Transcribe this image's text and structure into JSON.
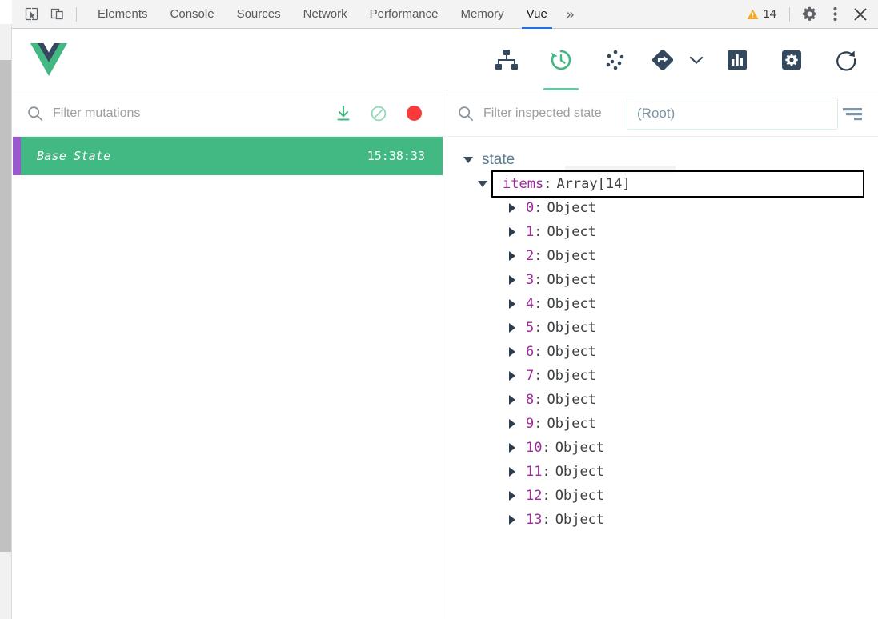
{
  "devtools": {
    "icons": {
      "inspect": "inspect-element-icon",
      "device": "device-toolbar-icon",
      "more": "»",
      "warning": "warning-triangle-icon",
      "settings": "gear-icon",
      "kebab": "more-options-icon",
      "close": "close-icon"
    },
    "tabs": [
      {
        "label": "Elements",
        "active": false
      },
      {
        "label": "Console",
        "active": false
      },
      {
        "label": "Sources",
        "active": false
      },
      {
        "label": "Network",
        "active": false
      },
      {
        "label": "Performance",
        "active": false
      },
      {
        "label": "Memory",
        "active": false
      },
      {
        "label": "Vue",
        "active": true
      }
    ],
    "more_label": "»",
    "warning_count": "14"
  },
  "vue_header": {
    "logo": "vue-logo",
    "accent": "#42b883",
    "tools": [
      {
        "name": "components-tree-icon",
        "active": false
      },
      {
        "name": "time-travel-icon",
        "active": true
      },
      {
        "name": "vuex-dots-icon",
        "active": false
      },
      {
        "name": "routing-icon",
        "active": false
      },
      {
        "name": "chevron-down-icon",
        "active": false
      },
      {
        "name": "performance-bars-icon",
        "active": false
      },
      {
        "name": "settings-gear-icon",
        "active": false
      },
      {
        "name": "refresh-icon",
        "active": false
      }
    ]
  },
  "left_pane": {
    "filter": {
      "placeholder": "Filter mutations",
      "value": ""
    },
    "actions": [
      {
        "name": "export-state-icon",
        "color": "#42b883"
      },
      {
        "name": "clear-mutations-icon",
        "color": "#8fd6b6"
      },
      {
        "name": "record-toggle-icon",
        "color": "#f93a3a"
      }
    ],
    "mutations": [
      {
        "label": "Base State",
        "time": "15:38:33",
        "selected": true,
        "bg": "#42b883",
        "marker": "#9b59d0"
      }
    ]
  },
  "right_pane": {
    "filter": {
      "placeholder": "Filter inspected state",
      "value": ""
    },
    "root_select": {
      "value": "(Root)",
      "border": "#d9f0e4"
    },
    "sort_icon": "sort-filter-icon",
    "tree": {
      "root_label": "state",
      "items_key": "items",
      "items_sep": ":",
      "items_value": "Array[14]",
      "children": [
        {
          "index": "0",
          "sep": ":",
          "value": "Object"
        },
        {
          "index": "1",
          "sep": ":",
          "value": "Object"
        },
        {
          "index": "2",
          "sep": ":",
          "value": "Object"
        },
        {
          "index": "3",
          "sep": ":",
          "value": "Object"
        },
        {
          "index": "4",
          "sep": ":",
          "value": "Object"
        },
        {
          "index": "5",
          "sep": ":",
          "value": "Object"
        },
        {
          "index": "6",
          "sep": ":",
          "value": "Object"
        },
        {
          "index": "7",
          "sep": ":",
          "value": "Object"
        },
        {
          "index": "8",
          "sep": ":",
          "value": "Object"
        },
        {
          "index": "9",
          "sep": ":",
          "value": "Object"
        },
        {
          "index": "10",
          "sep": ":",
          "value": "Object"
        },
        {
          "index": "11",
          "sep": ":",
          "value": "Object"
        },
        {
          "index": "12",
          "sep": ":",
          "value": "Object"
        },
        {
          "index": "13",
          "sep": ":",
          "value": "Object"
        }
      ]
    }
  }
}
